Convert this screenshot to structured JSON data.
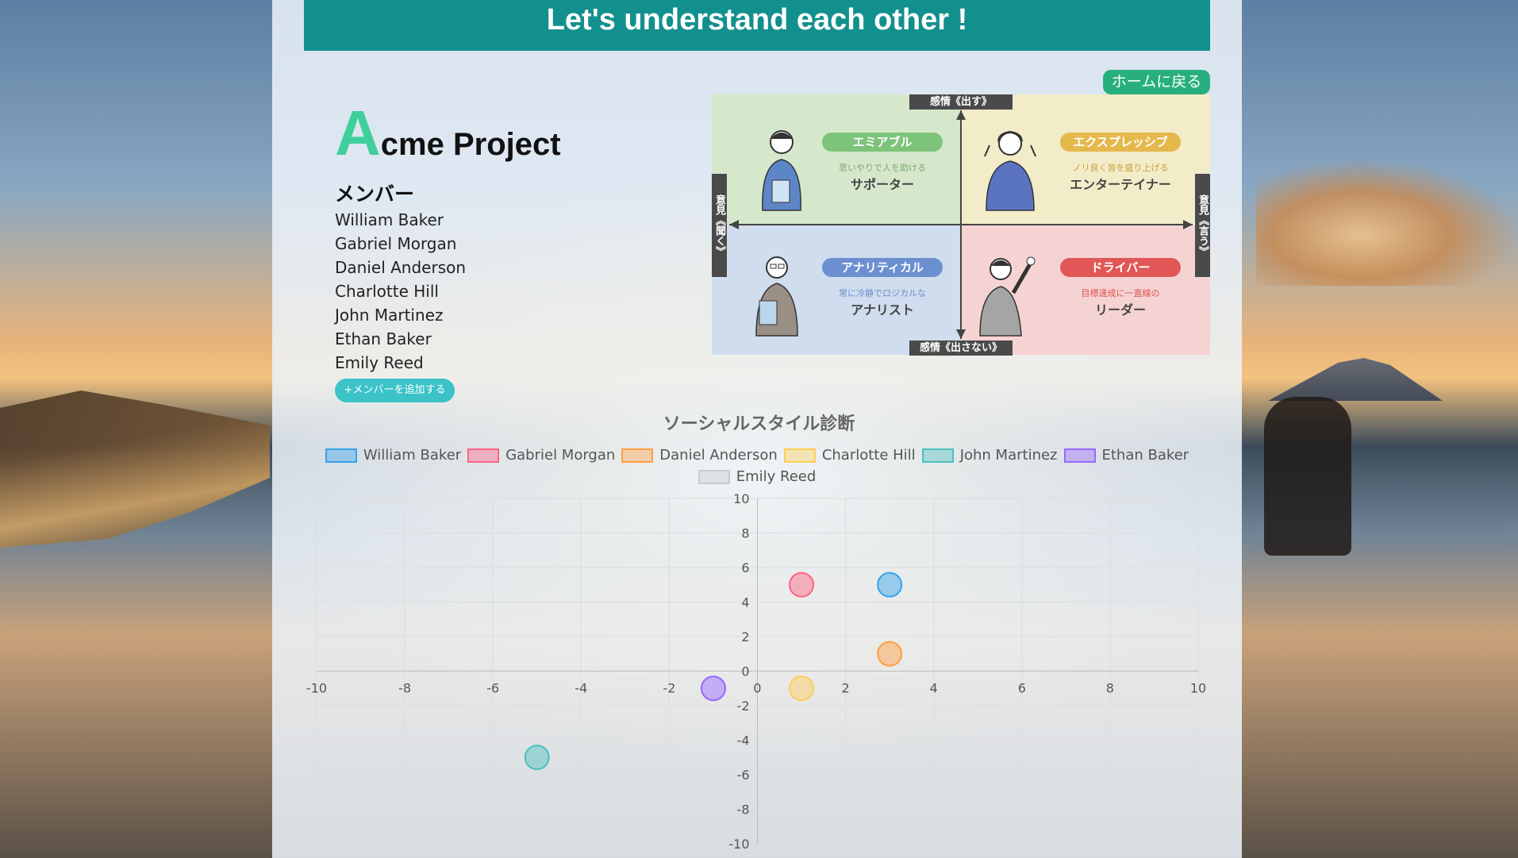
{
  "header": {
    "title": "Let's understand each other !"
  },
  "home_button": {
    "label": "ホームに戻る"
  },
  "project": {
    "title_initial": "A",
    "title_rest": "cme Project"
  },
  "members": {
    "label": "メンバー",
    "names": [
      "William Baker",
      "Gabriel Morgan",
      "Daniel Anderson",
      "Charlotte Hill",
      "John Martinez",
      "Ethan Baker",
      "Emily Reed"
    ],
    "add_button": "+メンバーを追加する"
  },
  "quadrant": {
    "axis_top": "感情《出す》",
    "axis_bottom": "感情《出さない》",
    "axis_left": "意見《聞く》",
    "axis_right": "意見《言う》",
    "top_left": {
      "name": "エミアブル",
      "desc": "思いやりで人を助ける",
      "role": "サポーター",
      "color": "#7dc37a"
    },
    "top_right": {
      "name": "エクスプレッシブ",
      "desc": "ノリ良く皆を盛り上げる",
      "role": "エンターテイナー",
      "color": "#e5b84c"
    },
    "bottom_left": {
      "name": "アナリティカル",
      "desc": "常に冷静でロジカルな",
      "role": "アナリスト",
      "color": "#6b8fd0"
    },
    "bottom_right": {
      "name": "ドライバー",
      "desc": "目標達成に一直線の",
      "role": "リーダー",
      "color": "#e15757"
    }
  },
  "chart_data": {
    "type": "scatter",
    "title": "ソーシャルスタイル診断",
    "xlim": [
      -10,
      10
    ],
    "ylim": [
      -10,
      10
    ],
    "x_ticks": [
      -10,
      -8,
      -6,
      -4,
      -2,
      0,
      2,
      4,
      6,
      8,
      10
    ],
    "y_ticks": [
      10,
      8,
      6,
      4,
      2,
      0,
      -2,
      -4,
      -6,
      -8,
      -10
    ],
    "grid": true,
    "legend_position": "top",
    "series": [
      {
        "name": "William Baker",
        "color": "#36a2eb",
        "points": [
          [
            3,
            5
          ]
        ]
      },
      {
        "name": "Gabriel Morgan",
        "color": "#ff6384",
        "points": [
          [
            1,
            5
          ]
        ]
      },
      {
        "name": "Daniel Anderson",
        "color": "#ff9f40",
        "points": [
          [
            3,
            1
          ]
        ]
      },
      {
        "name": "Charlotte Hill",
        "color": "#ffcd56",
        "points": [
          [
            1,
            -1
          ]
        ]
      },
      {
        "name": "John Martinez",
        "color": "#4bc0c0",
        "points": [
          [
            -5,
            -5
          ]
        ]
      },
      {
        "name": "Ethan Baker",
        "color": "#9966ff",
        "points": [
          [
            -1,
            -1
          ]
        ]
      },
      {
        "name": "Emily Reed",
        "color": "#c9cbcf",
        "points": []
      }
    ]
  }
}
